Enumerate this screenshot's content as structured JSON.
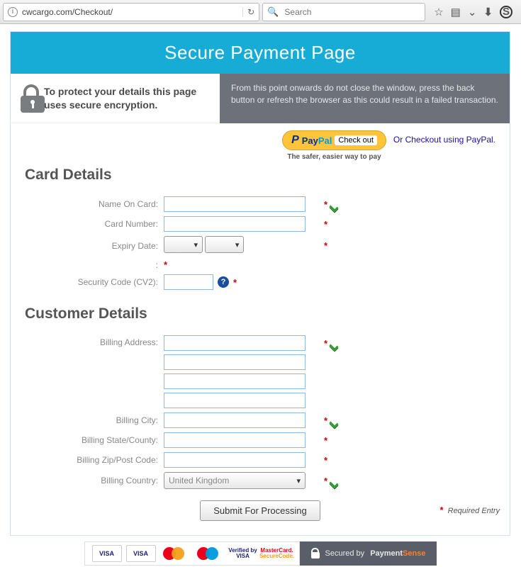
{
  "browser": {
    "url": "cwcargo.com/Checkout/",
    "search_placeholder": "Search"
  },
  "page": {
    "title": "Secure Payment Page",
    "protect_text": "To protect your details this page uses secure encryption.",
    "warning_text": "From this point onwards do not close the window, press the back button or refresh the browser as this could result in a failed transaction.",
    "paypal": {
      "brand_pay": "Pay",
      "brand_pal": "Pal",
      "checkout": "Check out",
      "sub": "The safer, easier way to pay",
      "alt_link": "Or Checkout using PayPal."
    },
    "sections": {
      "card": "Card Details",
      "customer": "Customer Details"
    },
    "labels": {
      "name_on_card": "Name On Card:",
      "card_number": "Card Number:",
      "expiry": "Expiry Date:",
      "colon": ":",
      "cv2": "Security Code (CV2):",
      "billing_address": "Billing Address:",
      "billing_city": "Billing City:",
      "billing_state": "Billing State/County:",
      "billing_zip": "Billing Zip/Post Code:",
      "billing_country": "Billing Country:"
    },
    "values": {
      "name_on_card": "",
      "card_number": "",
      "expiry_month": "",
      "expiry_year": "",
      "cv2": "",
      "billing_address_1": "",
      "billing_address_2": "",
      "billing_address_3": "",
      "billing_address_4": "",
      "billing_city": "",
      "billing_state": "",
      "billing_zip": "",
      "billing_country": "United Kingdom"
    },
    "submit": "Submit For Processing",
    "required_entry": "Required Entry"
  },
  "footer": {
    "visa": "VISA",
    "visa_electron": "VISA",
    "vbv_l1": "Verified by",
    "vbv_l2": "VISA",
    "msc_l1": "MasterCard.",
    "msc_l2": "SecureCode.",
    "secured_by": "Secured by",
    "brand_pre": "Payment",
    "brand_hl": "Sense"
  }
}
